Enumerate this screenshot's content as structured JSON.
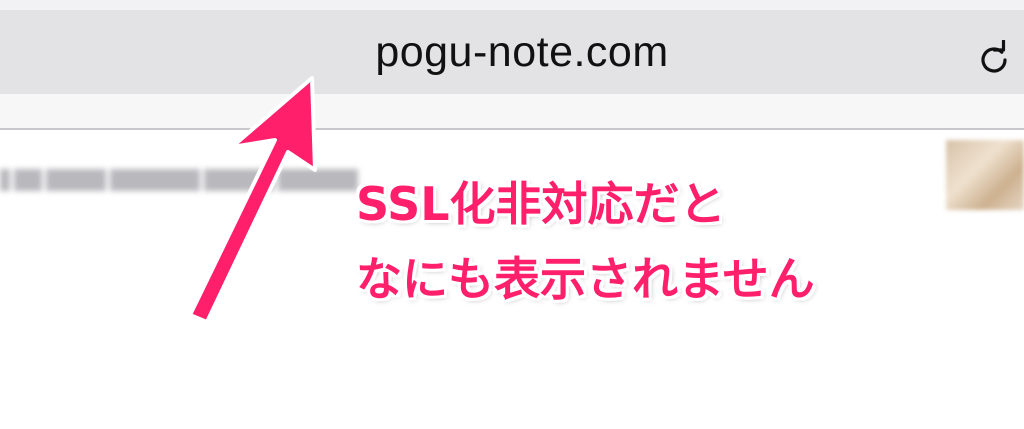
{
  "browser": {
    "url": "pogu-note.com",
    "reload_icon": "reload-icon"
  },
  "annotation": {
    "line1": "SSL化非対応だと",
    "line2": "なにも表示されません",
    "color": "#ff1f6a"
  },
  "icons": {
    "arrow": "annotation-arrow"
  }
}
